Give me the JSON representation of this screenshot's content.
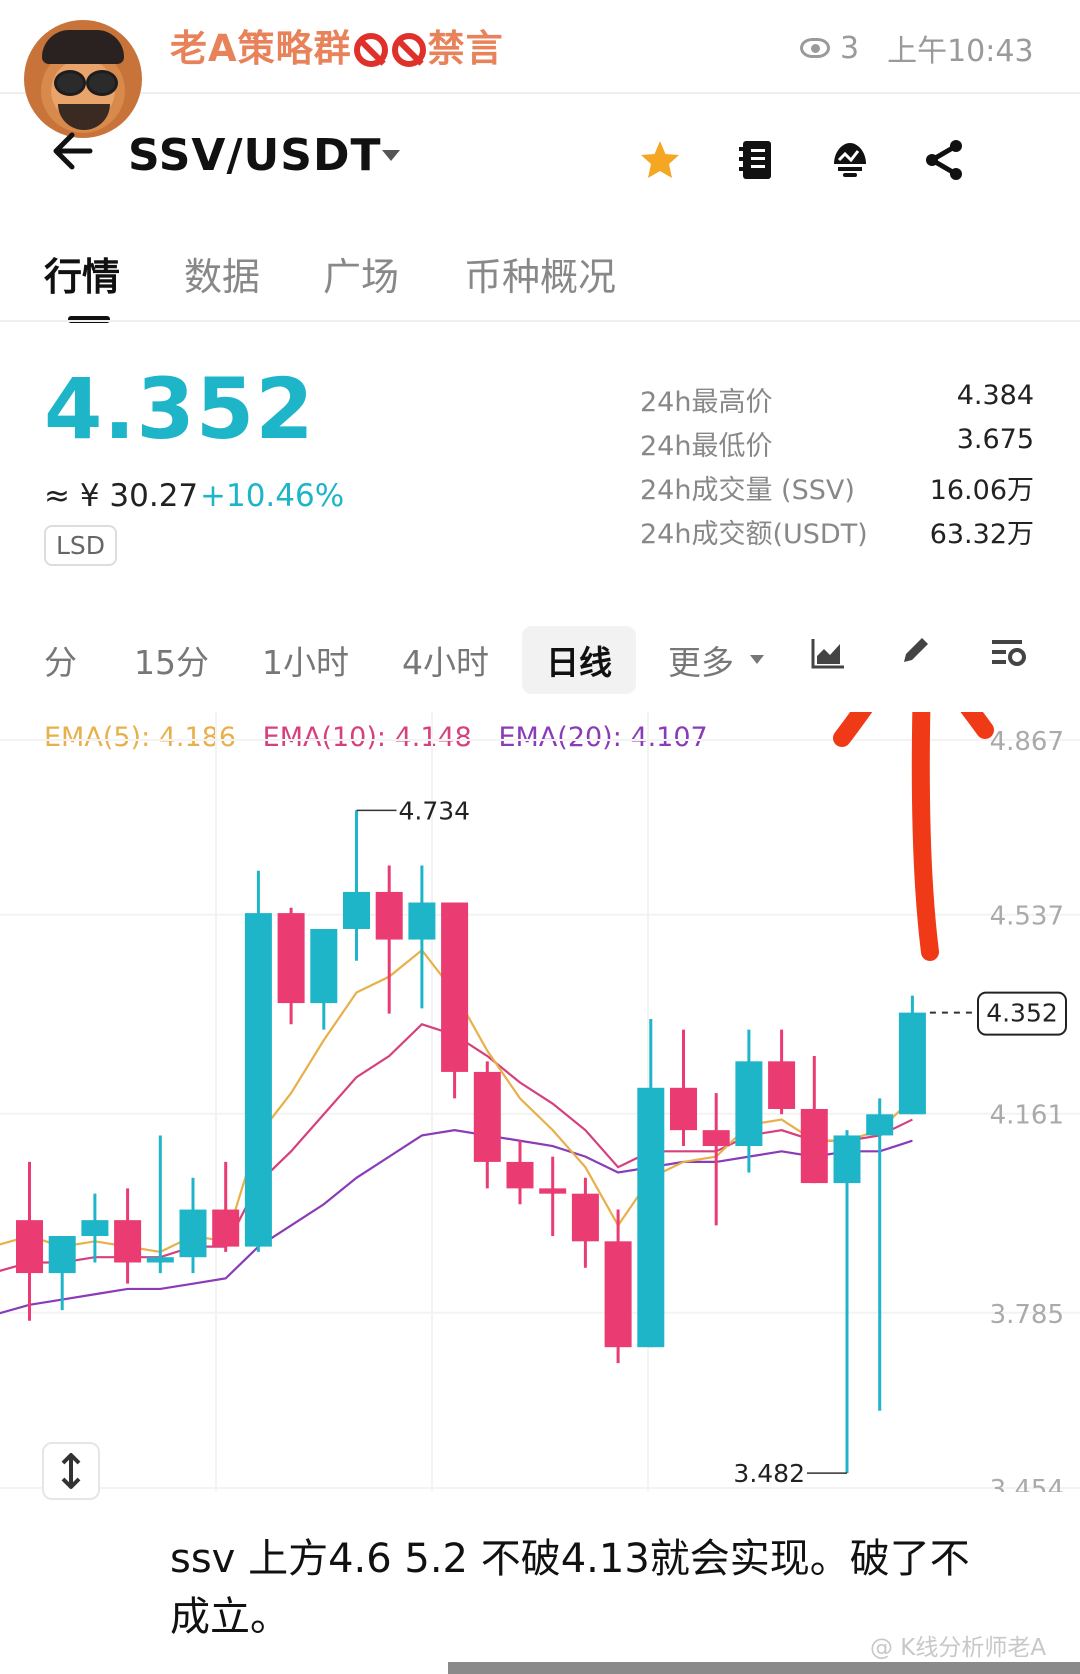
{
  "post": {
    "group_name": "老A策略群",
    "group_suffix": "禁言",
    "view_count": "3",
    "time": "上午10:43"
  },
  "toolbar": {
    "back_icon": "arrow-left-icon",
    "pair": "SSV/USDT",
    "icons": [
      "star-icon",
      "notebook-icon",
      "bot-icon",
      "share-icon"
    ],
    "star_color": "#f5a623"
  },
  "tabs": [
    {
      "label": "行情",
      "active": true
    },
    {
      "label": "数据",
      "active": false
    },
    {
      "label": "广场",
      "active": false
    },
    {
      "label": "币种概况",
      "active": false
    }
  ],
  "ticker": {
    "price": "4.352",
    "price_color": "#1fb5c9",
    "cny": "≈ ¥ 30.27",
    "change": "+10.46%",
    "tag": "LSD",
    "stats": [
      {
        "label": "24h最高价",
        "value": "4.384"
      },
      {
        "label": "24h最低价",
        "value": "3.675"
      },
      {
        "label": "24h成交量 (SSV)",
        "value": "16.06万"
      },
      {
        "label": "24h成交额(USDT)",
        "value": "63.32万"
      }
    ]
  },
  "timeframes": [
    {
      "label": "分",
      "active": false
    },
    {
      "label": "15分",
      "active": false
    },
    {
      "label": "1小时",
      "active": false
    },
    {
      "label": "4小时",
      "active": false
    },
    {
      "label": "日线",
      "active": true
    },
    {
      "label": "更多",
      "active": false
    }
  ],
  "chart_data": {
    "type": "candlestick",
    "ema": [
      {
        "label": "EMA(5): 4.186",
        "period": 5,
        "value": 4.186,
        "color": "#e8b04a"
      },
      {
        "label": "EMA(10): 4.148",
        "period": 10,
        "value": 4.148,
        "color": "#d6407e"
      },
      {
        "label": "EMA(20): 4.107",
        "period": 20,
        "value": 4.107,
        "color": "#8a3bb8"
      }
    ],
    "y_ticks": [
      4.867,
      4.537,
      4.161,
      3.785,
      3.454
    ],
    "y_tick_labels": [
      "4.867",
      "4.537",
      "4.161",
      "3.785",
      "3.454"
    ],
    "ylim": [
      3.454,
      4.867
    ],
    "up_color": "#1fb5c9",
    "down_color": "#ea3b72",
    "candles": [
      {
        "o": 3.96,
        "h": 4.07,
        "l": 3.77,
        "c": 3.86
      },
      {
        "o": 3.86,
        "h": 3.9,
        "l": 3.79,
        "c": 3.93
      },
      {
        "o": 3.93,
        "h": 4.01,
        "l": 3.88,
        "c": 3.96
      },
      {
        "o": 3.96,
        "h": 4.02,
        "l": 3.84,
        "c": 3.88
      },
      {
        "o": 3.88,
        "h": 4.12,
        "l": 3.86,
        "c": 3.89
      },
      {
        "o": 3.89,
        "h": 4.04,
        "l": 3.86,
        "c": 3.98
      },
      {
        "o": 3.98,
        "h": 4.07,
        "l": 3.9,
        "c": 3.91
      },
      {
        "o": 3.91,
        "h": 4.62,
        "l": 3.9,
        "c": 4.54
      },
      {
        "o": 4.54,
        "h": 4.55,
        "l": 4.33,
        "c": 4.37
      },
      {
        "o": 4.37,
        "h": 4.5,
        "l": 4.32,
        "c": 4.51
      },
      {
        "o": 4.51,
        "h": 4.734,
        "l": 4.45,
        "c": 4.58
      },
      {
        "o": 4.58,
        "h": 4.63,
        "l": 4.35,
        "c": 4.49
      },
      {
        "o": 4.49,
        "h": 4.63,
        "l": 4.36,
        "c": 4.56
      },
      {
        "o": 4.56,
        "h": 4.56,
        "l": 4.19,
        "c": 4.24
      },
      {
        "o": 4.24,
        "h": 4.26,
        "l": 4.02,
        "c": 4.07
      },
      {
        "o": 4.07,
        "h": 4.11,
        "l": 3.99,
        "c": 4.02
      },
      {
        "o": 4.02,
        "h": 4.08,
        "l": 3.93,
        "c": 4.01
      },
      {
        "o": 4.01,
        "h": 4.04,
        "l": 3.87,
        "c": 3.92
      },
      {
        "o": 3.92,
        "h": 3.98,
        "l": 3.69,
        "c": 3.72
      },
      {
        "o": 3.72,
        "h": 4.34,
        "l": 3.72,
        "c": 4.21
      },
      {
        "o": 4.21,
        "h": 4.32,
        "l": 4.1,
        "c": 4.13
      },
      {
        "o": 4.13,
        "h": 4.2,
        "l": 3.95,
        "c": 4.1
      },
      {
        "o": 4.1,
        "h": 4.32,
        "l": 4.05,
        "c": 4.26
      },
      {
        "o": 4.26,
        "h": 4.32,
        "l": 4.16,
        "c": 4.17
      },
      {
        "o": 4.17,
        "h": 4.27,
        "l": 4.03,
        "c": 4.03
      },
      {
        "o": 4.03,
        "h": 4.13,
        "l": 3.482,
        "c": 4.12
      },
      {
        "o": 4.12,
        "h": 4.19,
        "l": 3.6,
        "c": 4.16
      },
      {
        "o": 4.16,
        "h": 4.384,
        "l": 4.16,
        "c": 4.352
      }
    ],
    "ema5": [
      3.93,
      3.91,
      3.92,
      3.91,
      3.9,
      3.93,
      3.92,
      4.12,
      4.2,
      4.3,
      4.39,
      4.42,
      4.47,
      4.39,
      4.28,
      4.19,
      4.13,
      4.06,
      3.95,
      4.04,
      4.07,
      4.08,
      4.14,
      4.15,
      4.11,
      4.11,
      4.13,
      4.19
    ],
    "ema10": [
      3.88,
      3.88,
      3.89,
      3.89,
      3.89,
      3.91,
      3.91,
      4.03,
      4.09,
      4.16,
      4.23,
      4.27,
      4.33,
      4.31,
      4.27,
      4.22,
      4.18,
      4.13,
      4.06,
      4.09,
      4.09,
      4.09,
      4.12,
      4.13,
      4.11,
      4.11,
      4.12,
      4.15
    ],
    "ema20": [
      3.8,
      3.81,
      3.82,
      3.83,
      3.83,
      3.84,
      3.85,
      3.91,
      3.95,
      3.99,
      4.04,
      4.08,
      4.12,
      4.13,
      4.12,
      4.11,
      4.1,
      4.08,
      4.05,
      4.06,
      4.07,
      4.07,
      4.08,
      4.09,
      4.08,
      4.09,
      4.09,
      4.11
    ],
    "annotations": [
      {
        "label": "4.734",
        "value": 4.734,
        "candle": 10,
        "kind": "high"
      },
      {
        "label": "3.482",
        "value": 3.482,
        "candle": 25,
        "kind": "low"
      },
      {
        "label": "4.352",
        "value": 4.352,
        "kind": "last-price"
      }
    ]
  },
  "caption": "ssv  上方4.6   5.2  不破4.13就会实现。破了不成立。",
  "watermark": "@ K线分析师老A"
}
